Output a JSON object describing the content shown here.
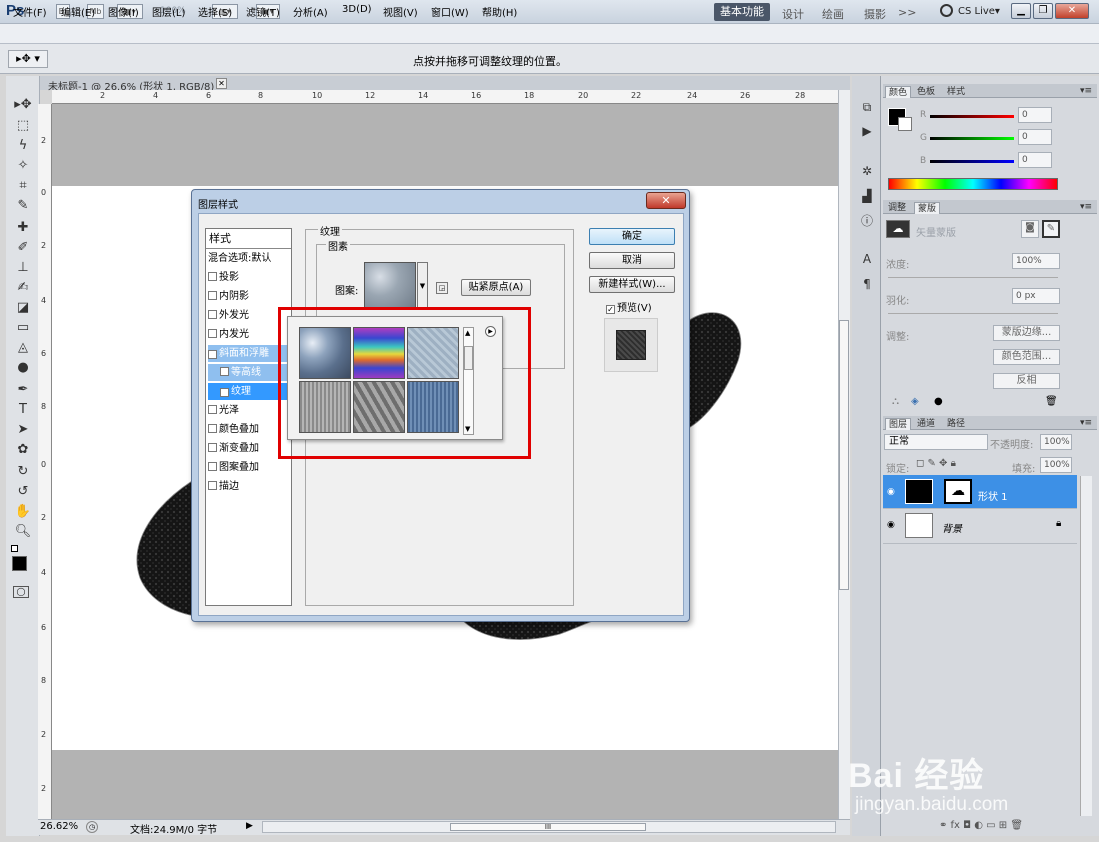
{
  "app": {
    "logo": "Ps",
    "zoom_dropdown": "100%",
    "workspaces": [
      "基本功能",
      "设计",
      "绘画",
      "摄影",
      ">>"
    ],
    "cs_live": "CS Live▾"
  },
  "menu": [
    "文件(F)",
    "编辑(E)",
    "图像(I)",
    "图层(L)",
    "选择(S)",
    "滤镜(T)",
    "分析(A)",
    "3D(D)",
    "视图(V)",
    "窗口(W)",
    "帮助(H)"
  ],
  "options_bar": {
    "hint": "点按并拖移可调整纹理的位置。"
  },
  "document": {
    "tab_title": "未标题-1 @ 26.6% (形状 1, RGB/8) *",
    "ruler_h": [
      "2",
      "4",
      "6",
      "8",
      "10",
      "12",
      "14",
      "16",
      "18",
      "20",
      "22",
      "24",
      "26",
      "28"
    ],
    "ruler_v": [
      "2",
      "0",
      "2",
      "4",
      "6",
      "8",
      "0",
      "2",
      "4",
      "6",
      "8",
      "2",
      "2"
    ],
    "status_zoom": "26.62%",
    "status_doc": "文档:24.9M/0 字节"
  },
  "color_panel": {
    "tabs": [
      "颜色",
      "色板",
      "样式"
    ],
    "channels": [
      {
        "label": "R",
        "value": "0",
        "color": "#e01010"
      },
      {
        "label": "G",
        "value": "0",
        "color": "#10b010"
      },
      {
        "label": "B",
        "value": "0",
        "color": "#1010e0"
      }
    ]
  },
  "masks_panel": {
    "tabs": [
      "调整",
      "蒙版"
    ],
    "title": "矢量蒙版",
    "density_label": "浓度:",
    "density_value": "100%",
    "feather_label": "羽化:",
    "feather_value": "0 px",
    "refine_label": "调整:",
    "buttons": [
      "蒙版边缘...",
      "颜色范围...",
      "反相"
    ]
  },
  "layers_panel": {
    "tabs": [
      "图层",
      "通道",
      "路径"
    ],
    "blend_mode": "正常",
    "opacity_label": "不透明度:",
    "opacity_value": "100%",
    "lock_label": "锁定:",
    "fill_label": "填充:",
    "fill_value": "100%",
    "layers": [
      {
        "name": "形状 1",
        "selected": true
      },
      {
        "name": "背景",
        "selected": false
      }
    ]
  },
  "dialog": {
    "title": "图层样式",
    "styles_header": "样式",
    "blend_options": "混合选项:默认",
    "styles": [
      {
        "label": "投影",
        "checked": false,
        "state": ""
      },
      {
        "label": "内阴影",
        "checked": false,
        "state": ""
      },
      {
        "label": "外发光",
        "checked": false,
        "state": ""
      },
      {
        "label": "内发光",
        "checked": false,
        "state": ""
      },
      {
        "label": "斜面和浮雕",
        "checked": true,
        "state": "light"
      },
      {
        "label": "等高线",
        "checked": false,
        "state": "sub"
      },
      {
        "label": "纹理",
        "checked": true,
        "state": "selected"
      },
      {
        "label": "光泽",
        "checked": false,
        "state": ""
      },
      {
        "label": "颜色叠加",
        "checked": false,
        "state": ""
      },
      {
        "label": "渐变叠加",
        "checked": false,
        "state": ""
      },
      {
        "label": "图案叠加",
        "checked": false,
        "state": ""
      },
      {
        "label": "描边",
        "checked": false,
        "state": ""
      }
    ],
    "section_title": "纹理",
    "elements_title": "图素",
    "pattern_label": "图案:",
    "snap_button": "贴紧原点(A)",
    "ok": "确定",
    "cancel": "取消",
    "new_style": "新建样式(W)...",
    "preview_label": "预览(V)"
  },
  "watermark": {
    "line1": "Bai 经验",
    "line2": "jingyan.baidu.com"
  }
}
